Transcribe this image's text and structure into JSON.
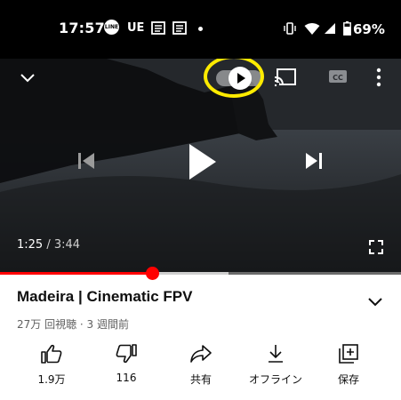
{
  "status_bar": {
    "time": "17:57",
    "line_icon_text": "LINE",
    "ue_label": "UE",
    "battery_percent": "69%"
  },
  "player": {
    "current_time": "1:25",
    "separator": " / ",
    "duration": "3:44",
    "progress_played": 0.38,
    "progress_buffered": 0.57,
    "highlight_color": "#ffeb00",
    "accent_color": "#ff0000"
  },
  "video": {
    "title": "Madeira | Cinematic FPV",
    "meta": "27万 回視聴 · 3 週間前"
  },
  "actions": [
    {
      "label": "1.9万"
    },
    {
      "label": "116"
    },
    {
      "label": "共有"
    },
    {
      "label": "オフライン"
    },
    {
      "label": "保存"
    }
  ]
}
